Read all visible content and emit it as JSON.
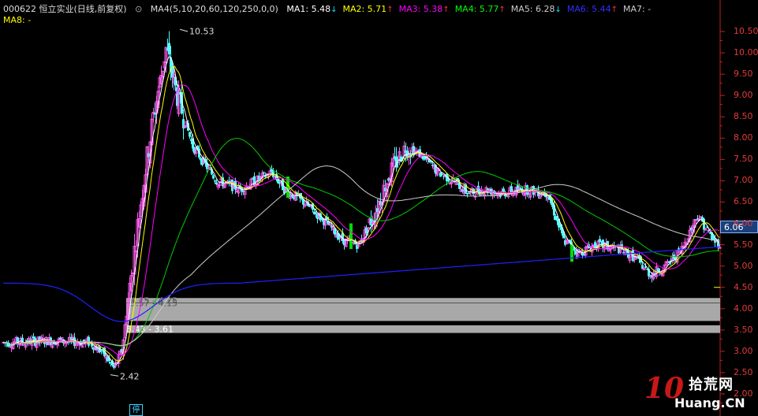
{
  "header": {
    "stock": "000622 恒立实业(日线,前复权)",
    "ma4_params": "MA4(5,10,20,60,120,250,0,0)",
    "ma_values": [
      {
        "label": "MA1:",
        "value": "5.48",
        "arrow": "↓",
        "color": "#ffffff",
        "arrow_color": "#00e5ff"
      },
      {
        "label": "MA2:",
        "value": "5.71",
        "arrow": "↑",
        "color": "#ffff00",
        "arrow_color": "#ff3030"
      },
      {
        "label": "MA3:",
        "value": "5.38",
        "arrow": "↑",
        "color": "#ff00ff",
        "arrow_color": "#ff3030"
      },
      {
        "label": "MA4:",
        "value": "5.77",
        "arrow": "↑",
        "color": "#00ff00",
        "arrow_color": "#ff3030"
      },
      {
        "label": "MA5:",
        "value": "6.28",
        "arrow": "↓",
        "color": "#cccccc",
        "arrow_color": "#00e5ff"
      },
      {
        "label": "MA6:",
        "value": "5.44",
        "arrow": "↑",
        "color": "#3030ff",
        "arrow_color": "#ff3030"
      },
      {
        "label": "MA7:",
        "value": "-",
        "arrow": "",
        "color": "#cccccc",
        "arrow_color": "#cccccc"
      }
    ],
    "ma8": "MA8: -"
  },
  "current_price": "6.06",
  "y_axis": {
    "ticks": [
      "10.50",
      "10.00",
      "9.50",
      "9.00",
      "8.50",
      "8.00",
      "7.50",
      "7.00",
      "6.50",
      "6.00",
      "5.50",
      "5.00",
      "4.50",
      "4.00",
      "3.50",
      "3.00",
      "2.50",
      "2.00"
    ],
    "min": 2.0,
    "max": 10.5
  },
  "annotations": {
    "high": "10.53",
    "low": "2.42",
    "band1": "4.15 - 4.25",
    "band2": "3.57 - 4.15",
    "band3": "3.43 - 3.61",
    "stop_badge": "停"
  },
  "watermark": {
    "num": "10",
    "cn": "拾荒网",
    "en": "Huang.CN"
  },
  "colors": {
    "up": "#ff5cf0",
    "down": "#54ffff",
    "bear_solid": "#00dd00",
    "axis": "#e23b3b"
  }
}
